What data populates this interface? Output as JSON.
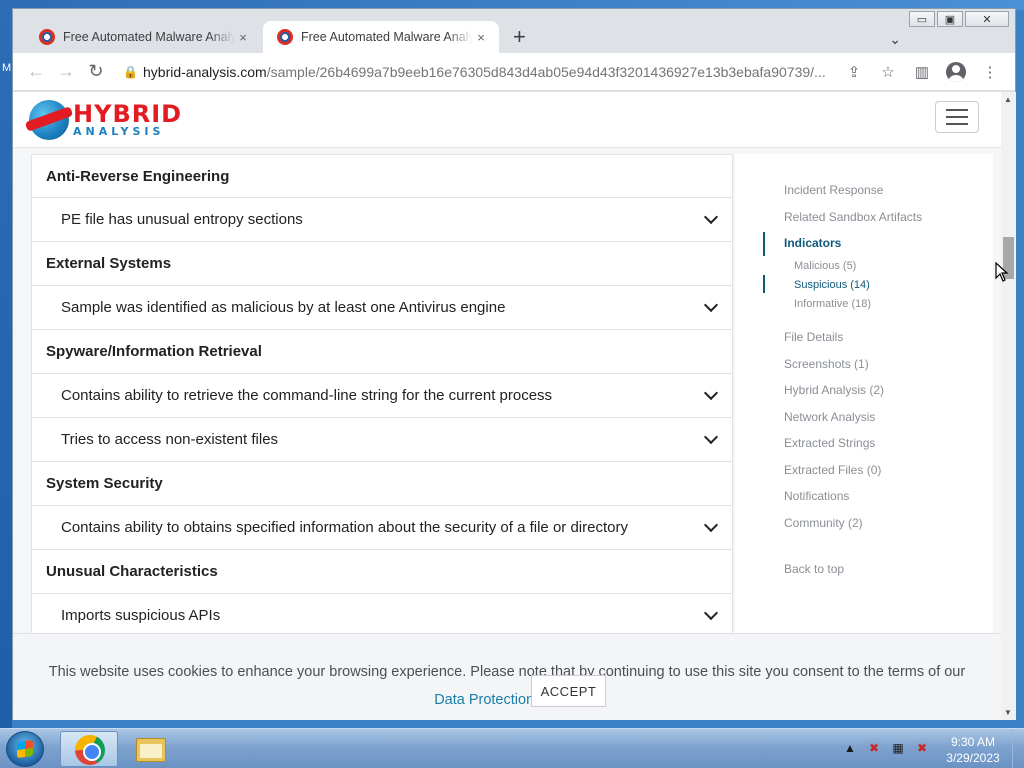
{
  "desktop": {
    "edge_label": "M"
  },
  "window": {
    "minimize": "▭",
    "maximize": "▣",
    "close": "✕"
  },
  "tabs": [
    {
      "title": "Free Automated Malware Analysis Service",
      "close": "×"
    },
    {
      "title": "Free Automated Malware Analysis Service",
      "close": "×"
    }
  ],
  "new_tab": "+",
  "tab_search": "⌄",
  "toolbar": {
    "back": "←",
    "forward": "→",
    "reload": "↻",
    "url_host": "hybrid-analysis.com",
    "url_path": "/sample/26b4699a7b9eeb16e76305d843d4ab05e94d43f3201436927e13b3ebafa90739/...",
    "share": "⇪",
    "bookmark": "☆",
    "sidebar": "▥",
    "menu": "⋮"
  },
  "site": {
    "logo_top": "HYBRID",
    "logo_bottom": "ANALYSIS"
  },
  "indicators": [
    {
      "type": "category",
      "label": "Anti-Reverse Engineering"
    },
    {
      "type": "item",
      "label": "PE file has unusual entropy sections"
    },
    {
      "type": "category",
      "label": "External Systems"
    },
    {
      "type": "item",
      "label": "Sample was identified as malicious by at least one Antivirus engine"
    },
    {
      "type": "category",
      "label": "Spyware/Information Retrieval"
    },
    {
      "type": "item",
      "label": "Contains ability to retrieve the command-line string for the current process"
    },
    {
      "type": "item",
      "label": "Tries to access non-existent files"
    },
    {
      "type": "category",
      "label": "System Security"
    },
    {
      "type": "item",
      "label": "Contains ability to obtains specified information about the security of a file or directory"
    },
    {
      "type": "category",
      "label": "Unusual Characteristics"
    },
    {
      "type": "item",
      "label": "Imports suspicious APIs"
    }
  ],
  "sidebar_nav": [
    {
      "label": "Incident Response",
      "active": false,
      "sub": false
    },
    {
      "label": "Related Sandbox Artifacts",
      "active": false,
      "sub": false
    },
    {
      "label": "Indicators",
      "active": true,
      "sub": false
    },
    {
      "label": "Malicious (5)",
      "active": false,
      "sub": true
    },
    {
      "label": "Suspicious (14)",
      "active": true,
      "sub": true
    },
    {
      "label": "Informative (18)",
      "active": false,
      "sub": true
    },
    {
      "label": "File Details",
      "active": false,
      "sub": false
    },
    {
      "label": "Screenshots (1)",
      "active": false,
      "sub": false
    },
    {
      "label": "Hybrid Analysis (2)",
      "active": false,
      "sub": false
    },
    {
      "label": "Network Analysis",
      "active": false,
      "sub": false
    },
    {
      "label": "Extracted Strings",
      "active": false,
      "sub": false
    },
    {
      "label": "Extracted Files (0)",
      "active": false,
      "sub": false
    },
    {
      "label": "Notifications",
      "active": false,
      "sub": false
    },
    {
      "label": "Community (2)",
      "active": false,
      "sub": false
    },
    {
      "label": "Back to top",
      "active": false,
      "sub": false
    }
  ],
  "cookie_banner": {
    "text": "This website uses cookies to enhance your browsing experience. Please note that by continuing to use this site you consent to the terms of our ",
    "link": "Data Protection Policy.",
    "accept": "ACCEPT"
  },
  "scrollbar": {
    "up": "▲",
    "down": "▼"
  },
  "taskbar": {
    "time": "9:30 AM",
    "date": "3/29/2023",
    "tray_arrow": "▲",
    "tray_icons": [
      "✖",
      "▦",
      "✖"
    ]
  }
}
